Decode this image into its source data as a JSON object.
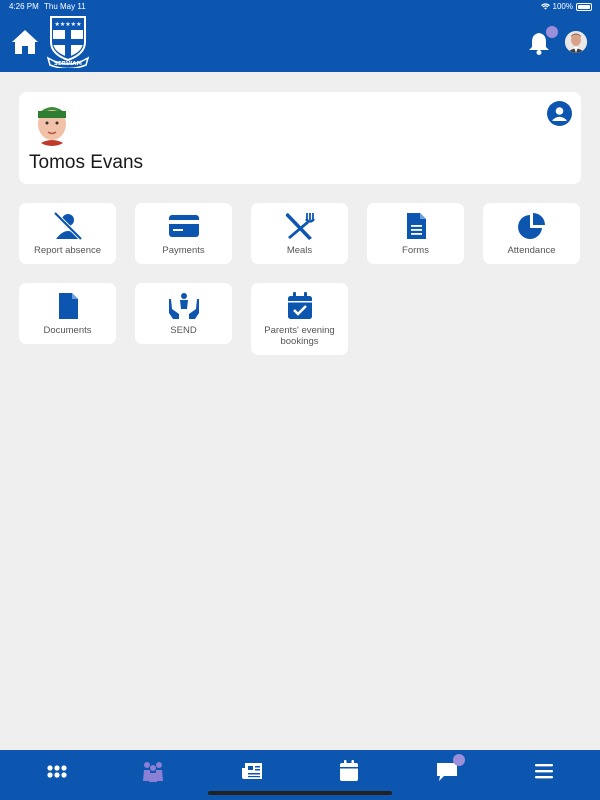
{
  "status_bar": {
    "time": "4:26 PM",
    "date": "Thu May 11",
    "battery": "100%"
  },
  "header": {
    "crest_text": "SERVIAM",
    "icons": [
      "home-icon",
      "school-crest",
      "bell-icon",
      "user-avatar"
    ],
    "brand_color": "#0d56b0",
    "badge_color": "#9b8fd9"
  },
  "profile": {
    "name": "Tomos Evans"
  },
  "tiles": [
    {
      "label": "Report absence",
      "icon": "user-slash-icon"
    },
    {
      "label": "Payments",
      "icon": "credit-card-icon"
    },
    {
      "label": "Meals",
      "icon": "utensils-icon"
    },
    {
      "label": "Forms",
      "icon": "file-lines-icon"
    },
    {
      "label": "Attendance",
      "icon": "pie-chart-icon"
    },
    {
      "label": "Documents",
      "icon": "file-icon"
    },
    {
      "label": "SEND",
      "icon": "hands-holding-child-icon"
    },
    {
      "label": "Parents' evening bookings",
      "icon": "calendar-check-icon"
    }
  ],
  "bottom_nav": {
    "items": [
      "grid-icon",
      "people-icon",
      "newspaper-icon",
      "calendar-icon",
      "chat-icon",
      "menu-icon"
    ],
    "active_color": "#8b7fd6"
  }
}
